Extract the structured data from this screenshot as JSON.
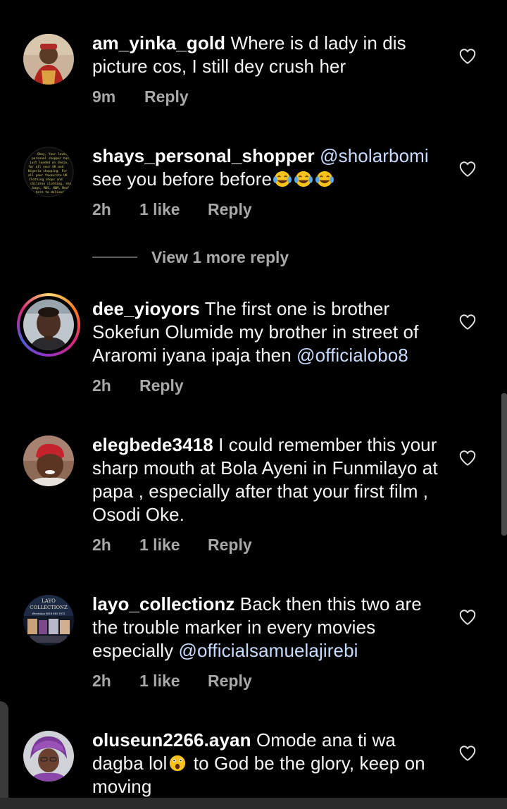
{
  "comments": [
    {
      "username": "am_yinka_gold",
      "text": "Where is d lady in dis picture cos, I still dey crush her",
      "time": "9m",
      "likes": "",
      "reply": "Reply",
      "heart_icon": "heart-outline-icon"
    },
    {
      "username": "shays_personal_shopper",
      "mention": "@sholarbomi",
      "text": "see you before before",
      "emoji": [
        "joy",
        "joy",
        "joy"
      ],
      "time": "2h",
      "likes": "1 like",
      "reply": "Reply",
      "heart_icon": "heart-outline-icon"
    },
    {
      "username": "dee_yioyors",
      "text": "The first one is brother Sokefun Olumide my brother in street of Araromi iyana ipaja then",
      "mention": "@officialobo8",
      "time": "2h",
      "likes": "",
      "reply": "Reply",
      "has_story": true,
      "heart_icon": "heart-outline-icon"
    },
    {
      "username": "elegbede3418",
      "text": "I could remember this your sharp mouth at Bola Ayeni in Funmilayo at papa , especially after that your first film , Osodi Oke.",
      "time": "2h",
      "likes": "1 like",
      "reply": "Reply",
      "heart_icon": "heart-outline-icon"
    },
    {
      "username": "layo_collectionz",
      "text": "Back then this two are the trouble marker in every movies especially",
      "mention": "@officialsamuelajirebi",
      "time": "2h",
      "likes": "1 like",
      "reply": "Reply",
      "heart_icon": "heart-outline-icon"
    },
    {
      "username": "oluseun2266.ayan",
      "text_before_emoji": "Omode ana ti wa dagba lol",
      "emoji": [
        "astonished"
      ],
      "text_after_emoji": "to God be the glory, keep on moving",
      "heart_icon": "heart-outline-icon"
    }
  ],
  "view_more_replies": "View 1 more reply",
  "avatar_texts": {
    "shays": "Okay, Your lovely personal shopper has just landed on Ikeja, for all your UK and Nigeria shopping. For all your favourite UK clothing shops and children clothing, shoes, bags, M&S, H&M, Next... Quad like geez on... here to deliver",
    "layo_line1": "LAYO",
    "layo_line2": "COLLECTIONZ",
    "layo_line3": "WhatsApp 0818 661 7672"
  },
  "colors": {
    "background": "#000000",
    "text": "#f5f5f5",
    "secondary": "#a8a8a8",
    "mention": "#c9dcff"
  }
}
